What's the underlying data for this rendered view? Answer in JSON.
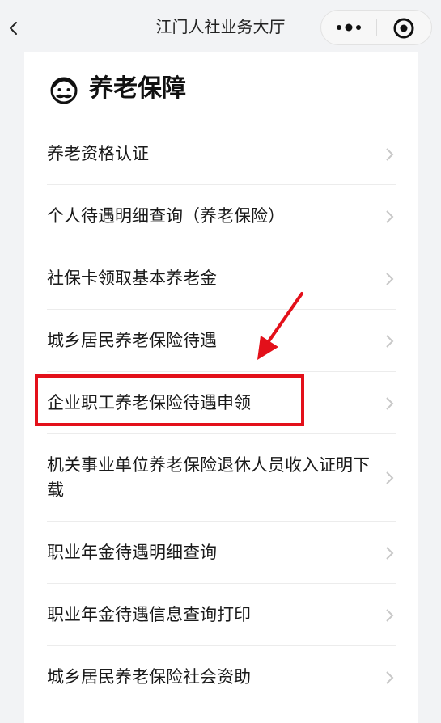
{
  "nav": {
    "title": "江门人社业务大厅",
    "back_icon": "chevron-left-icon",
    "more_icon": "more-dots-icon",
    "close_icon": "target-circle-icon"
  },
  "section": {
    "icon": "grandpa-face-icon",
    "title": "养老保障"
  },
  "menu": {
    "items": [
      {
        "label": "养老资格认证"
      },
      {
        "label": "个人待遇明细查询（养老保险）"
      },
      {
        "label": "社保卡领取基本养老金"
      },
      {
        "label": "城乡居民养老保险待遇"
      },
      {
        "label": "企业职工养老保险待遇申领"
      },
      {
        "label": "机关事业单位养老保险退休人员收入证明下载"
      },
      {
        "label": "职业年金待遇明细查询"
      },
      {
        "label": "职业年金待遇信息查询打印"
      },
      {
        "label": "城乡居民养老保险社会资助"
      }
    ]
  },
  "annotation": {
    "highlighted_item": "企业职工养老保险待遇申领",
    "color": "#e3101a"
  },
  "colors": {
    "background": "#f2f3f5",
    "card": "#ffffff",
    "text": "#1a1a1a",
    "divider": "#ececec",
    "chevron": "#c8c8c8"
  }
}
